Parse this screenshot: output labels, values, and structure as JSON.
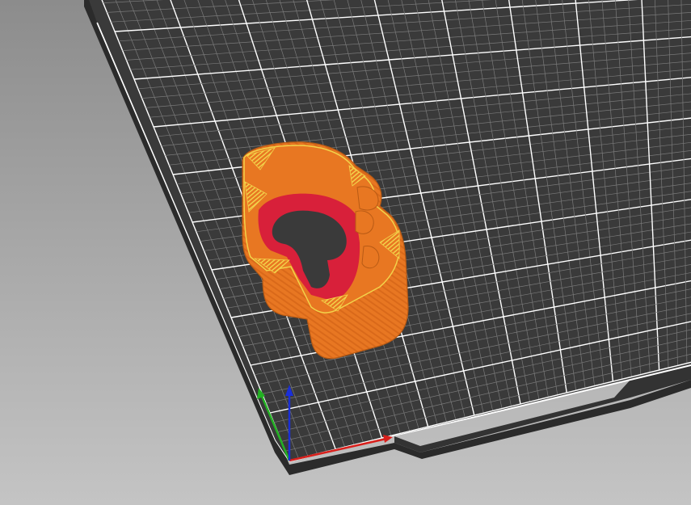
{
  "viewport": {
    "kind": "3d-slicer-preview",
    "bed": {
      "surface_color": "#3a3a3a",
      "edge_color": "#2b2b2b",
      "grid_fine_color": "#7a7a7a",
      "grid_major_color": "#ffffff",
      "background_top": "#8c8c8c",
      "background_bottom": "#c4c4c4"
    },
    "model": {
      "perimeter_color": "#e87722",
      "perimeter_dark_color": "#b85a14",
      "infill_color": "#f2d24a",
      "internal_color": "#d8203a"
    },
    "axes": {
      "x_color": "#d8201c",
      "y_color": "#22b022",
      "z_color": "#1a2fd8"
    }
  }
}
